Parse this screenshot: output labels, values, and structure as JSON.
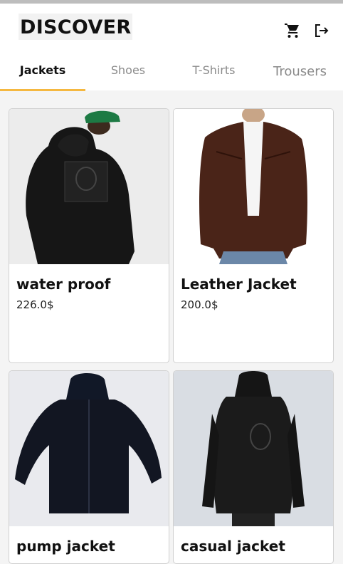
{
  "header": {
    "title": "DISCOVER",
    "icons": [
      "cart-icon",
      "logout-icon"
    ]
  },
  "tabs": [
    {
      "label": "Jackets",
      "active": true
    },
    {
      "label": "Shoes",
      "active": false
    },
    {
      "label": "T-Shirts",
      "active": false
    },
    {
      "label": "Trousers",
      "active": false
    }
  ],
  "products": [
    {
      "name": "water proof",
      "price": "226.0$"
    },
    {
      "name": "Leather Jacket",
      "price": "200.0$"
    },
    {
      "name": "pump jacket",
      "price": ""
    },
    {
      "name": "casual jacket",
      "price": ""
    }
  ],
  "colors": {
    "accent": "#f5b840",
    "background": "#f4f4f4",
    "card": "#ffffff"
  }
}
